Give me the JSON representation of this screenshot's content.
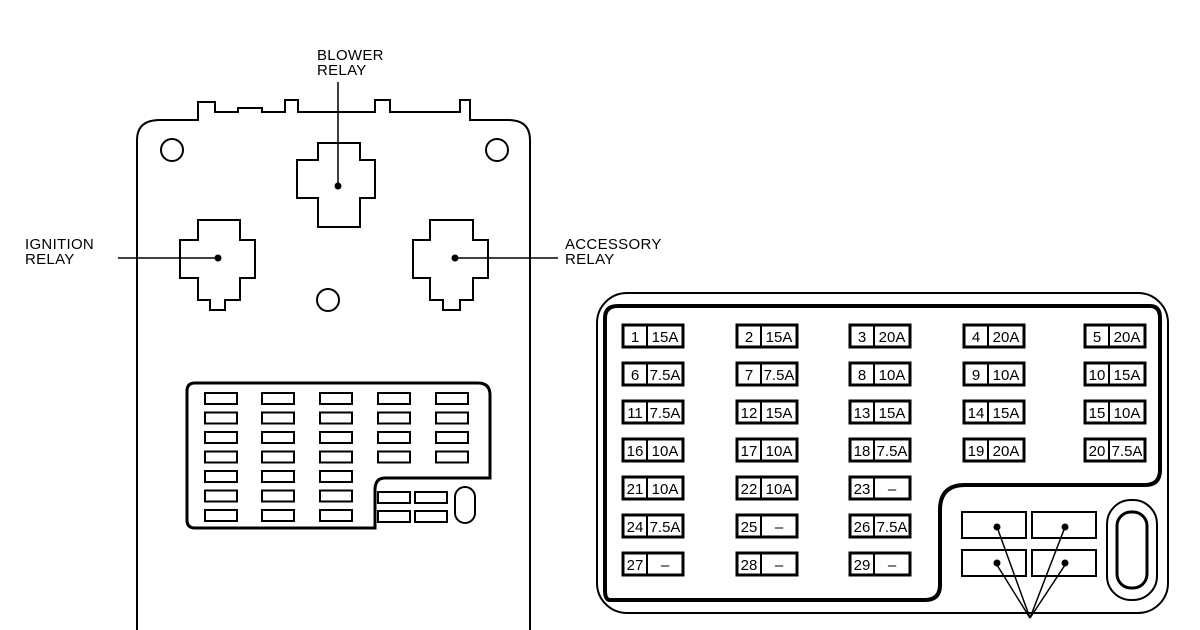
{
  "labels": {
    "blower": [
      "BLOWER",
      "RELAY"
    ],
    "ignition": [
      "IGNITION",
      "RELAY"
    ],
    "accessory": [
      "ACCESSORY",
      "RELAY"
    ]
  },
  "fuses": [
    {
      "n": "1",
      "a": "15A"
    },
    {
      "n": "2",
      "a": "15A"
    },
    {
      "n": "3",
      "a": "20A"
    },
    {
      "n": "4",
      "a": "20A"
    },
    {
      "n": "5",
      "a": "20A"
    },
    {
      "n": "6",
      "a": "7.5A"
    },
    {
      "n": "7",
      "a": "7.5A"
    },
    {
      "n": "8",
      "a": "10A"
    },
    {
      "n": "9",
      "a": "10A"
    },
    {
      "n": "10",
      "a": "15A"
    },
    {
      "n": "11",
      "a": "7.5A"
    },
    {
      "n": "12",
      "a": "15A"
    },
    {
      "n": "13",
      "a": "15A"
    },
    {
      "n": "14",
      "a": "15A"
    },
    {
      "n": "15",
      "a": "10A"
    },
    {
      "n": "16",
      "a": "10A"
    },
    {
      "n": "17",
      "a": "10A"
    },
    {
      "n": "18",
      "a": "7.5A"
    },
    {
      "n": "19",
      "a": "20A"
    },
    {
      "n": "20",
      "a": "7.5A"
    },
    {
      "n": "21",
      "a": "10A"
    },
    {
      "n": "22",
      "a": "10A"
    },
    {
      "n": "23",
      "a": "–"
    },
    {
      "n": "24",
      "a": "7.5A"
    },
    {
      "n": "25",
      "a": "–"
    },
    {
      "n": "26",
      "a": "7.5A"
    },
    {
      "n": "27",
      "a": "–"
    },
    {
      "n": "28",
      "a": "–"
    },
    {
      "n": "29",
      "a": "–"
    }
  ],
  "colors": {
    "ink": "#000000",
    "paper": "#ffffff"
  }
}
